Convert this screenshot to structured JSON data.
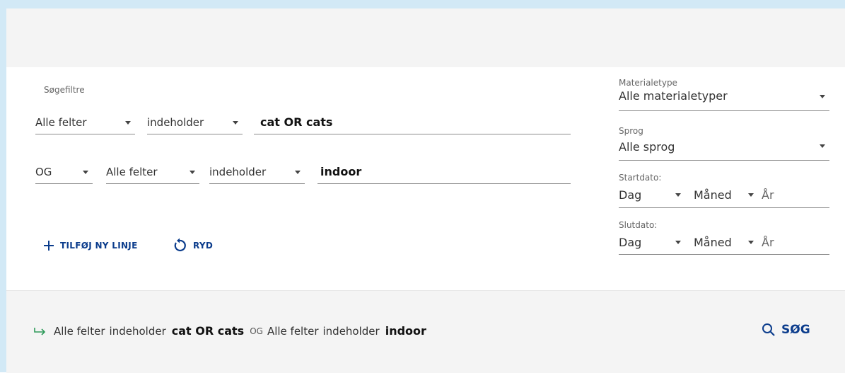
{
  "filters_label": "Søgefiltre",
  "row1": {
    "field": "Alle felter",
    "operator": "indeholder",
    "query": "cat OR cats"
  },
  "row2": {
    "boolean": "OG",
    "field": "Alle felter",
    "operator": "indeholder",
    "query": "indoor"
  },
  "actions": {
    "add_line": "TILFØJ NY LINJE",
    "clear": "RYD"
  },
  "material": {
    "label": "Materialetype",
    "value": "Alle materialetyper"
  },
  "language": {
    "label": "Sprog",
    "value": "Alle sprog"
  },
  "start_date": {
    "label": "Startdato:",
    "day": "Dag",
    "month": "Måned",
    "year": "År"
  },
  "end_date": {
    "label": "Slutdato:",
    "day": "Dag",
    "month": "Måned",
    "year": "År"
  },
  "summary": {
    "field1": "Alle felter",
    "op1": "indeholder",
    "q1": "cat OR cats",
    "bool": "OG",
    "field2": "Alle felter",
    "op2": "indeholder",
    "q2": "indoor"
  },
  "search_label": "SØG",
  "colors": {
    "accent": "#0b3c8c",
    "frame": "#d2e9f6",
    "band": "#f4f4f4",
    "summary_arrow": "#2e9a5a"
  },
  "icons": {
    "add": "plus-icon",
    "clear": "reset-icon",
    "search": "search-icon",
    "summary": "arrow-right-icon"
  }
}
